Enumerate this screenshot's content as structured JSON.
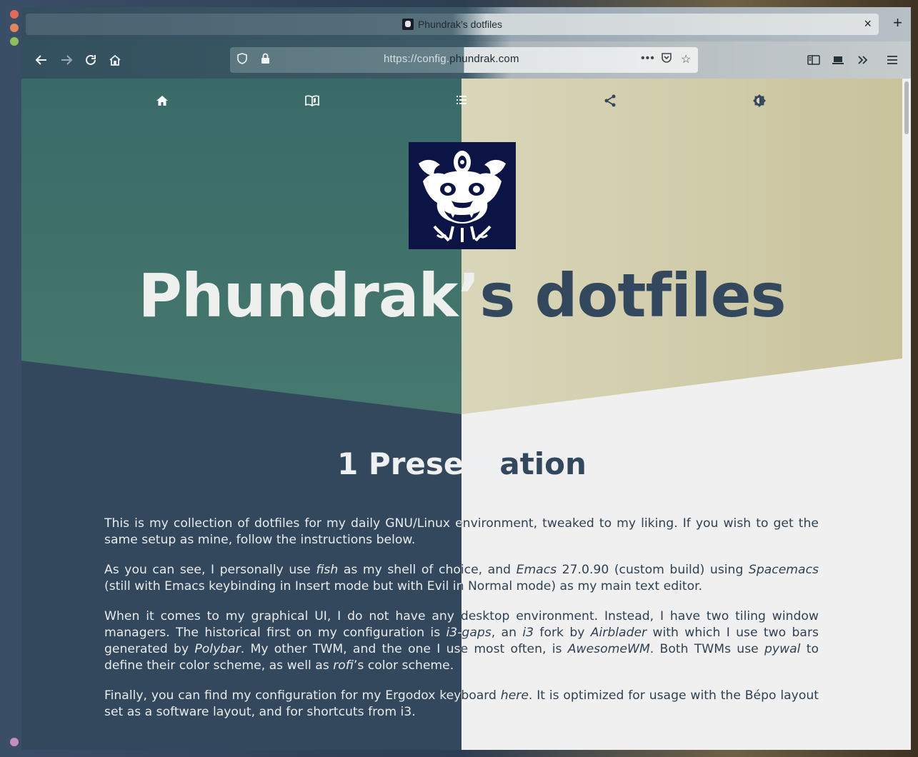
{
  "colors": {
    "close_dot": "#e46b5b",
    "minimize_dot": "#e0875e",
    "maximize_dot": "#8fbf5f",
    "bottom_dot": "#c58fba",
    "teal": "#46766d",
    "navy": "#33475d",
    "sand": "#d7d3b6",
    "page_bg": "#f0f0f0"
  },
  "browser": {
    "tab_title": "Phundrak’s dotfiles",
    "url_prefix": "https://config.",
    "url_host": "phundrak.com",
    "new_tab_label": "+",
    "close_tab_label": "×"
  },
  "page_nav": {
    "items": [
      {
        "name": "home-icon",
        "glyph": "⌂"
      },
      {
        "name": "book-icon",
        "glyph": "📖"
      },
      {
        "name": "toc-icon",
        "glyph": "☰"
      },
      {
        "name": "share-icon",
        "glyph": "⋖"
      },
      {
        "name": "theme-toggle-icon",
        "glyph": "◐"
      }
    ]
  },
  "header": {
    "title_left": "Phundrak’",
    "title_right": "s dotfiles"
  },
  "section": {
    "title": "1 Presentation"
  },
  "paragraphs": {
    "p1": "This is my collection of dotfiles for my daily GNU/Linux environment, tweaked to my liking. If you wish to get the same setup as mine, follow the instructions below.",
    "p2_a": "As you can see, I personally use ",
    "p2_fish": "fish",
    "p2_b": " as my shell of choice, and ",
    "p2_emacs": "Emacs",
    "p2_c": " 27.0.90 (custom build) using ",
    "p2_spacemacs": "Spacemacs",
    "p2_d": " (still with Emacs keybinding in Insert mode but with Evil in Normal mode) as my main text editor.",
    "p3_a": "When it comes to my graphical UI, I do not have any desktop environment. Instead, I have two tiling window managers. The historical first on my configuration is ",
    "p3_i3gaps": "i3-gaps",
    "p3_b": ", an ",
    "p3_i3": "i3",
    "p3_c": " fork by ",
    "p3_airblader": "Airblader",
    "p3_d": " with which I use two bars generated by ",
    "p3_polybar": "Polybar",
    "p3_e": ". My other TWM, and the one I use most often, is ",
    "p3_awesome": "AwesomeWM",
    "p3_f": ". Both TWMs use ",
    "p3_pywal": "pywal",
    "p3_g": " to define their color scheme, as well as ",
    "p3_rofi": "rofi",
    "p3_h": "’s color scheme.",
    "p4_a": "Finally, you can find my configuration for my Ergodox keyboard ",
    "p4_here": "here",
    "p4_b": ". It is optimized for usage with the Bépo layout set as a software layout, and for shortcuts from i3."
  }
}
